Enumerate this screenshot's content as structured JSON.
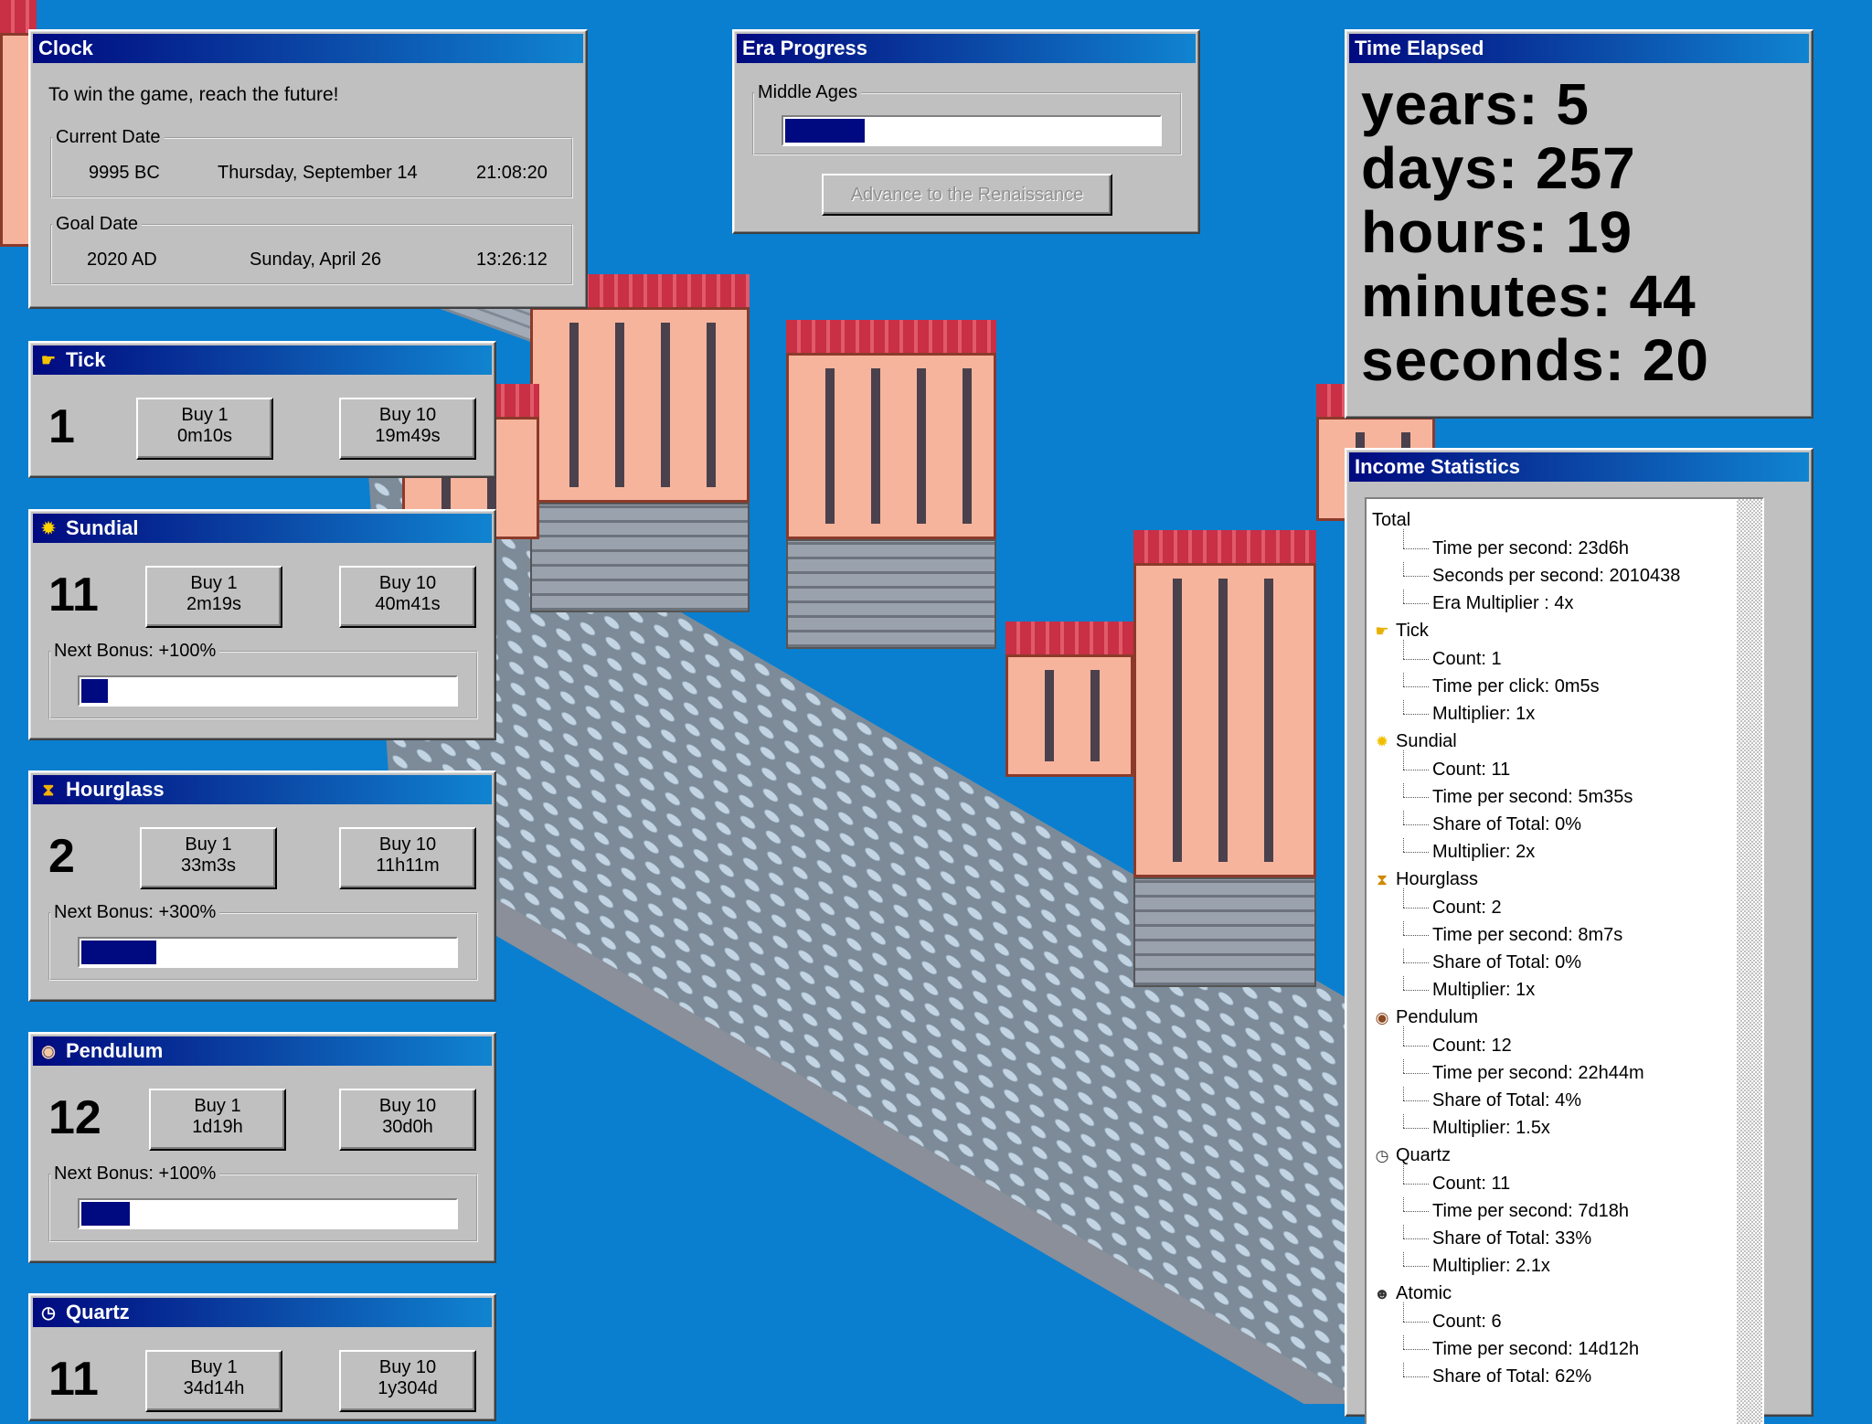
{
  "clock": {
    "title": "Clock",
    "message": "To win the game, reach the future!",
    "current_date": {
      "legend": "Current Date",
      "year": "9995 BC",
      "day": "Thursday, September 14",
      "time": "21:08:20"
    },
    "goal_date": {
      "legend": "Goal Date",
      "year": "2020 AD",
      "day": "Sunday, April 26",
      "time": "13:26:12"
    }
  },
  "era": {
    "title": "Era Progress",
    "legend": "Middle Ages",
    "progress": 0.21,
    "advance_button": "Advance to the Renaissance"
  },
  "time_elapsed": {
    "title": "Time Elapsed",
    "years": "years: 5",
    "days": "days: 257",
    "hours": "hours: 19",
    "minutes": "minutes: 44",
    "seconds": "seconds: 20"
  },
  "generators": [
    {
      "name": "Tick",
      "icon": "pointing-hand-icon",
      "count": "1",
      "buy1_label": "Buy 1",
      "buy1_cost": "0m10s",
      "buy10_label": "Buy 10",
      "buy10_cost": "19m49s"
    },
    {
      "name": "Sundial",
      "icon": "sun-icon",
      "count": "11",
      "buy1_label": "Buy 1",
      "buy1_cost": "2m19s",
      "buy10_label": "Buy 10",
      "buy10_cost": "40m41s",
      "bonus": "Next Bonus: +100%",
      "bonus_progress": 0.07
    },
    {
      "name": "Hourglass",
      "icon": "hourglass-icon",
      "count": "2",
      "buy1_label": "Buy 1",
      "buy1_cost": "33m3s",
      "buy10_label": "Buy 10",
      "buy10_cost": "11h11m",
      "bonus": "Next Bonus: +300%",
      "bonus_progress": 0.2
    },
    {
      "name": "Pendulum",
      "icon": "pendulum-clock-icon",
      "count": "12",
      "buy1_label": "Buy 1",
      "buy1_cost": "1d19h",
      "buy10_label": "Buy 10",
      "buy10_cost": "30d0h",
      "bonus": "Next Bonus: +100%",
      "bonus_progress": 0.13
    },
    {
      "name": "Quartz",
      "icon": "watch-icon",
      "count": "11",
      "buy1_label": "Buy 1",
      "buy1_cost": "34d14h",
      "buy10_label": "Buy 10",
      "buy10_cost": "1y304d"
    }
  ],
  "income": {
    "title": "Income Statistics",
    "total": {
      "label": "Total",
      "items": [
        "Time per second: 23d6h",
        "Seconds per second: 2010438",
        "Era Multiplier : 4x"
      ]
    },
    "groups": [
      {
        "label": "Tick",
        "icon": "pointing-hand-icon",
        "items": [
          "Count: 1",
          "Time per click: 0m5s",
          "Multiplier: 1x"
        ]
      },
      {
        "label": "Sundial",
        "icon": "sun-icon",
        "items": [
          "Count: 11",
          "Time per second: 5m35s",
          "Share of Total: 0%",
          "Multiplier: 2x"
        ]
      },
      {
        "label": "Hourglass",
        "icon": "hourglass-icon",
        "items": [
          "Count: 2",
          "Time per second: 8m7s",
          "Share of Total: 0%",
          "Multiplier: 1x"
        ]
      },
      {
        "label": "Pendulum",
        "icon": "pendulum-clock-icon",
        "items": [
          "Count: 12",
          "Time per second: 22h44m",
          "Share of Total: 4%",
          "Multiplier: 1.5x"
        ]
      },
      {
        "label": "Quartz",
        "icon": "watch-icon",
        "items": [
          "Count: 11",
          "Time per second: 7d18h",
          "Share of Total: 33%",
          "Multiplier: 2.1x"
        ]
      },
      {
        "label": "Atomic",
        "icon": "atom-face-icon",
        "items": [
          "Count: 6",
          "Time per second: 14d12h",
          "Share of Total: 62%"
        ]
      }
    ]
  },
  "colors": {
    "desktop": "#0a7fd0",
    "titlebar_start": "#000a80",
    "titlebar_end": "#1084d0",
    "window": "#c0c0c0",
    "progress_fill": "#000a80"
  }
}
